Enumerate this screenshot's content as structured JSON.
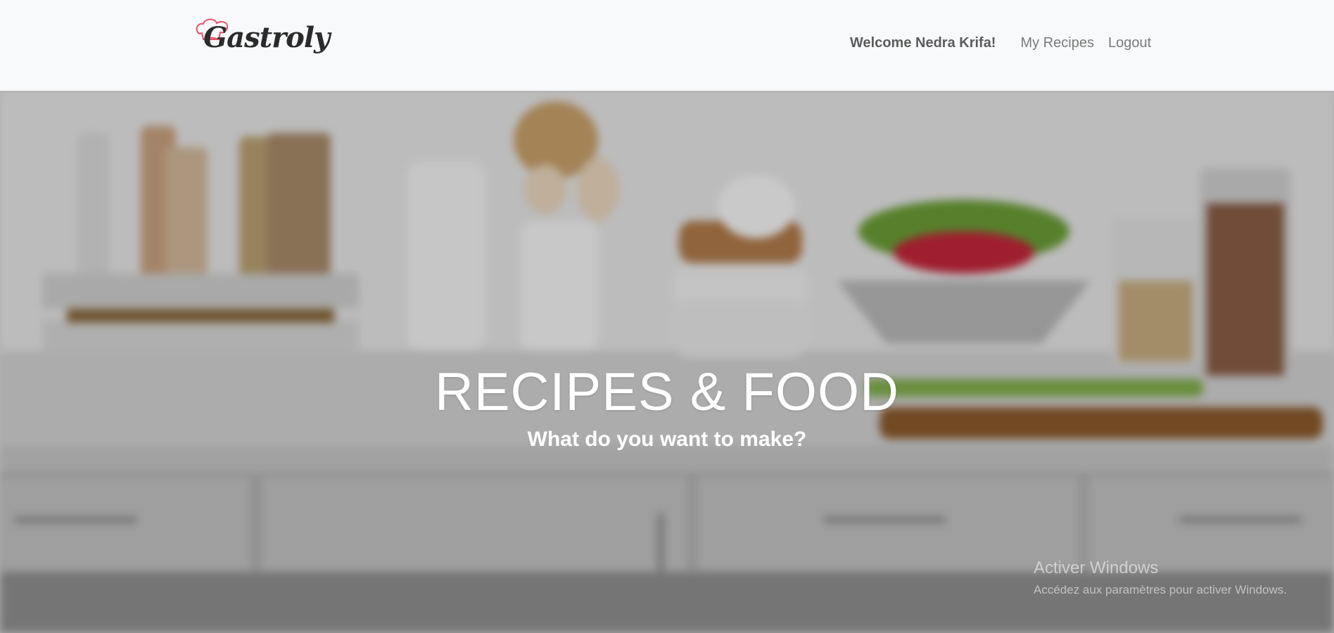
{
  "navbar": {
    "brand_name": "Gastroly",
    "welcome_text": "Welcome Nedra Krifa!",
    "links": [
      "My Recipes",
      "Logout"
    ]
  },
  "hero": {
    "title": "RECIPES & FOOD",
    "subtitle": "What do you want to make?"
  },
  "watermark": {
    "title": "Activer Windows",
    "subtitle": "Accédez aux paramètres pour activer Windows."
  },
  "colors": {
    "navbar_bg": "#f8f9fb",
    "brand_text": "#2b2b2b",
    "brand_hat": "#e8536b",
    "nav_text": "#7a7a7a",
    "hero_text": "#ffffff"
  }
}
